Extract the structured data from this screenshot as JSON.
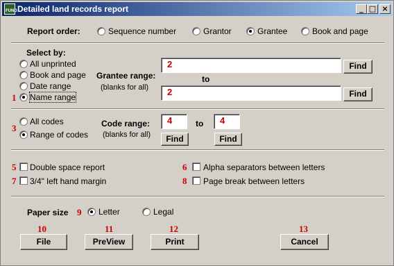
{
  "window": {
    "title": "Detailed land records report",
    "icon_text": "FUND",
    "controls": {
      "minimize": "_",
      "maximize": "□",
      "close": "×"
    }
  },
  "report_order": {
    "label": "Report order:",
    "options": [
      "Sequence number",
      "Grantor",
      "Grantee",
      "Book and page"
    ],
    "selected": "Grantee"
  },
  "select_by": {
    "label": "Select by:",
    "options": [
      "All unprinted",
      "Book and page",
      "Date range",
      "Name range"
    ],
    "selected": "Name range",
    "grantee_range_label": "Grantee range:",
    "blanks_hint": "(blanks for all)",
    "to_label": "to",
    "from_value": "2",
    "to_value": "2",
    "find_label": "Find"
  },
  "codes": {
    "options": [
      "All codes",
      "Range of codes"
    ],
    "selected": "Range of codes",
    "code_range_label": "Code range:",
    "blanks_hint": "(blanks for all)",
    "to_label": "to",
    "from_value": "4",
    "to_value": "4",
    "find_label": "Find"
  },
  "options": {
    "double_space": "Double space report",
    "left_margin": "3/4\" left hand margin",
    "alpha_separators": "Alpha separators between letters",
    "page_break": "Page break between letters"
  },
  "paper_size": {
    "label": "Paper size",
    "options": [
      "Letter",
      "Legal"
    ],
    "selected": "Letter"
  },
  "buttons": {
    "file": "File",
    "preview": "PreView",
    "print": "Print",
    "cancel": "Cancel"
  },
  "markers": [
    "1",
    "3",
    "5",
    "6",
    "7",
    "8",
    "9",
    "10",
    "11",
    "12",
    "13"
  ]
}
